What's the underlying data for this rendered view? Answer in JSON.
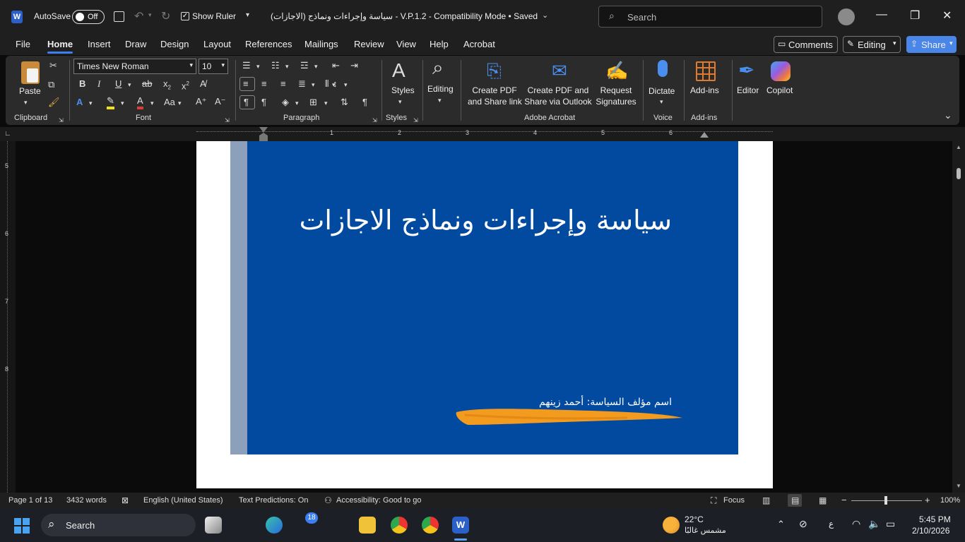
{
  "titlebar": {
    "autosave_label": "AutoSave",
    "autosave_state": "Off",
    "show_ruler_label": "Show Ruler",
    "doc_title": "(الاجازات) سياسة وإجراءات ونماذج  - V.P.1.2  -  Compatibility Mode • Saved",
    "search_placeholder": "Search"
  },
  "menu": {
    "tabs": [
      "File",
      "Home",
      "Insert",
      "Draw",
      "Design",
      "Layout",
      "References",
      "Mailings",
      "Review",
      "View",
      "Help",
      "Acrobat"
    ],
    "active": "Home",
    "comments": "Comments",
    "editing": "Editing",
    "share": "Share"
  },
  "ribbon": {
    "clipboard": {
      "label": "Clipboard",
      "paste": "Paste"
    },
    "font": {
      "label": "Font",
      "family": "Times New Roman",
      "size": "10"
    },
    "paragraph": {
      "label": "Paragraph"
    },
    "styles": {
      "label": "Styles",
      "button": "Styles"
    },
    "editing": {
      "button": "Editing"
    },
    "acrobat": {
      "label": "Adobe Acrobat",
      "create_pdf_1": "Create PDF",
      "create_pdf_2": "and Share link",
      "outlook_1": "Create PDF and",
      "outlook_2": "Share via Outlook",
      "sign_1": "Request",
      "sign_2": "Signatures"
    },
    "voice": {
      "label": "Voice",
      "button": "Dictate"
    },
    "addins": {
      "label": "Add-ins",
      "button": "Add-ins"
    },
    "editor": "Editor",
    "copilot": "Copilot"
  },
  "ruler": {
    "numbers": [
      "1",
      "2",
      "3",
      "4",
      "5",
      "6"
    ],
    "vnumbers": [
      "5",
      "6",
      "7",
      "8"
    ]
  },
  "document": {
    "title": "سياسة وإجراءات ونماذج الاجازات",
    "author_line": "اسم مؤلف السياسة: أحمد زينهم"
  },
  "status": {
    "page": "Page 1 of 13",
    "words": "3432 words",
    "language": "English (United States)",
    "predictions": "Text Predictions: On",
    "accessibility": "Accessibility: Good to go",
    "focus": "Focus",
    "zoom": "100%"
  },
  "taskbar": {
    "search": "Search",
    "badge": "18",
    "weather_temp": "22°C",
    "weather_desc": "مشمس غالبًا",
    "lang": "ع",
    "time": "5:45 PM",
    "date": "2/10/2026"
  },
  "colors": {
    "cover_blue": "#014aa0",
    "strip": "#8da0bb",
    "accent": "#3b7ff0",
    "highlight_orange": "#f39b1e"
  }
}
